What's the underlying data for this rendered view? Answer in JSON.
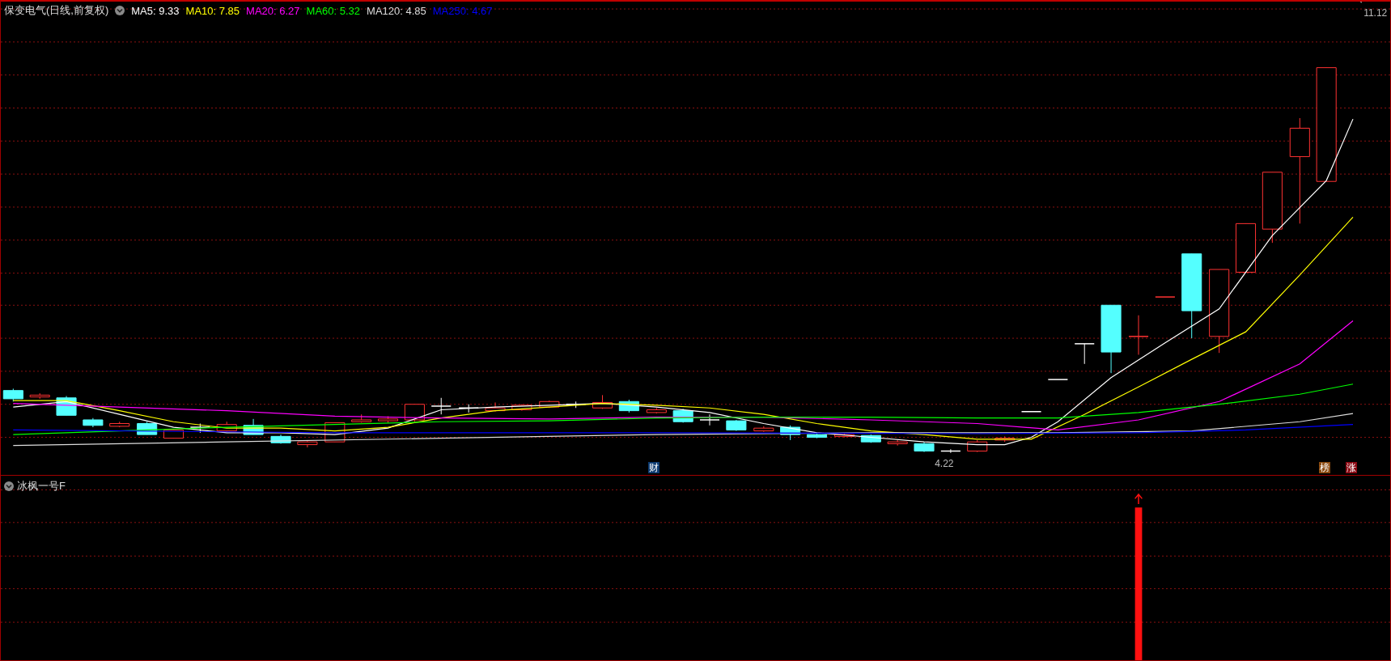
{
  "chart_header": {
    "title": "保变电气(日线,前复权)",
    "ma_legend": [
      {
        "label": "MA5: 9.33",
        "color": "#ffffff"
      },
      {
        "label": "MA10: 7.85",
        "color": "#ffff00"
      },
      {
        "label": "MA20: 6.27",
        "color": "#ff00ff"
      },
      {
        "label": "MA60: 5.32",
        "color": "#00ff00"
      },
      {
        "label": "MA120: 4.85",
        "color": "#dddddd"
      },
      {
        "label": "MA250: 4.67",
        "color": "#0000ff"
      }
    ]
  },
  "price_marks": {
    "high": "11.12",
    "low": "4.22"
  },
  "event_tags": [
    {
      "label": "财",
      "color": "#0c3a70"
    },
    {
      "label": "榜",
      "color": "#8a4a10"
    },
    {
      "label": "涨",
      "color": "#8a0a14"
    }
  ],
  "indicator_panel": {
    "title": "冰枫一号F"
  }
}
